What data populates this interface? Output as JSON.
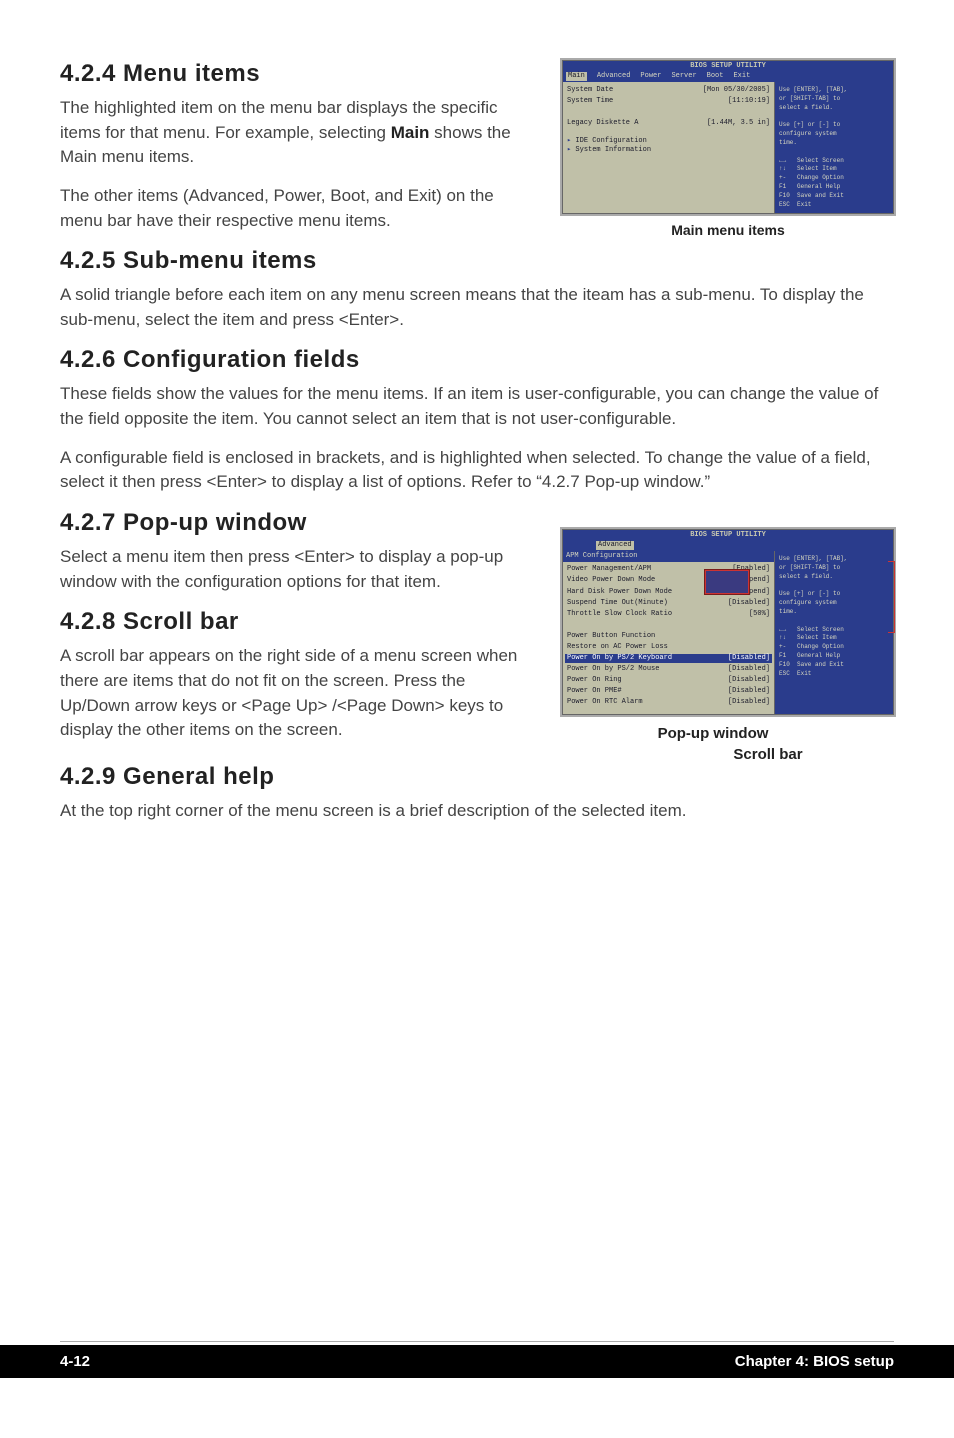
{
  "s424": {
    "heading": "4.2.4   Menu items",
    "p1a": "The highlighted item on the menu bar displays the specific items for that menu. For example, selecting ",
    "p1b": "Main",
    "p1c": " shows the Main menu items.",
    "p2": "The other items (Advanced, Power, Boot, and Exit) on the menu bar have their respective menu items.",
    "caption": "Main menu items"
  },
  "bios1": {
    "title": "BIOS SETUP UTILITY",
    "menubar": [
      "Main",
      "Advanced",
      "Power",
      "Server",
      "Boot",
      "Exit"
    ],
    "lines": [
      {
        "l": "System Date",
        "r": "[Mon 05/30/2005]"
      },
      {
        "l": "System Time",
        "r": "[11:10:19]"
      },
      {
        "l": "",
        "r": ""
      },
      {
        "l": "Legacy Diskette A",
        "r": "[1.44M, 3.5 in]"
      }
    ],
    "subs": [
      "IDE Configuration",
      "System Information"
    ],
    "help": [
      "Use [ENTER], [TAB],",
      "or [SHIFT-TAB] to",
      "select a field.",
      "",
      "Use [+] or [-] to",
      "configure system",
      "time.",
      "",
      "←→   Select Screen",
      "↑↓   Select Item",
      "+-   Change Option",
      "F1   General Help",
      "F10  Save and Exit",
      "ESC  Exit"
    ]
  },
  "s425": {
    "heading": "4.2.5   Sub-menu items",
    "p1": "A solid triangle before each item on any menu screen means that the iteam has a sub-menu. To display the sub-menu, select the item and press <Enter>."
  },
  "s426": {
    "heading": "4.2.6   Configuration fields",
    "p1": "These fields show the values for the menu items. If an item is user-configurable, you can change the value of the field opposite the item. You cannot select an item that is not user-configurable.",
    "p2": "A configurable field is enclosed in brackets, and is highlighted when selected. To change the value of a field, select it then press <Enter> to display a list of options. Refer to “4.2.7 Pop-up window.”"
  },
  "s427": {
    "heading": "4.2.7   Pop-up window",
    "p1": "Select a menu item then press <Enter> to display a pop-up window with the configuration options for that item."
  },
  "s428": {
    "heading": "4.2.8   Scroll bar",
    "p1": "A scroll bar appears on the right side of a menu screen when there are items that do not fit on the screen. Press the Up/Down arrow keys or <Page Up> /<Page Down> keys to display the other items on the screen."
  },
  "bios2": {
    "title": "BIOS SETUP UTILITY",
    "menubar_sel": "Advanced",
    "apm_title": "APM Configuration",
    "lines": [
      {
        "l": "Power Management/APM",
        "r": "[Enabled]"
      },
      {
        "l": "Video Power Down Mode",
        "r": "[Suspend]"
      },
      {
        "l": "Hard Disk Power Down Mode",
        "r": "[Suspend]"
      },
      {
        "l": "Suspend Time Out(Minute)",
        "r": "[Disabled]"
      },
      {
        "l": "Throttle Slow Clock Ratio",
        "r": "[50%]"
      },
      {
        "l": "",
        "r": ""
      },
      {
        "l": "Power Button Function",
        "r": ""
      },
      {
        "l": "Restore on AC Power Loss",
        "r": ""
      }
    ],
    "hl": {
      "l": "Power On by PS/2 Keyboard",
      "r": "[Disabled]"
    },
    "after": [
      {
        "l": "Power On by PS/2 Mouse",
        "r": "[Disabled]"
      },
      {
        "l": "Power On Ring",
        "r": "[Disabled]"
      },
      {
        "l": "Power On PME#",
        "r": "[Disabled]"
      },
      {
        "l": "Power On RTC Alarm",
        "r": "[Disabled]"
      }
    ],
    "help": [
      "Use [ENTER], [TAB],",
      "or [SHIFT-TAB] to",
      "select a field.",
      "",
      "Use [+] or [-] to",
      "configure system",
      "time.",
      "",
      "←→   Select Screen",
      "↑↓   Select Item",
      "+-   Change Option",
      "F1   General Help",
      "F10  Save and Exit",
      "ESC  Exit"
    ],
    "label_popup": "Pop-up window",
    "label_scroll": "Scroll bar"
  },
  "s429": {
    "heading": "4.2.9   General help",
    "p1": "At the top right corner of the menu screen is a brief description of the selected item."
  },
  "footer": {
    "left": "4-12",
    "right": "Chapter 4: BIOS setup"
  }
}
